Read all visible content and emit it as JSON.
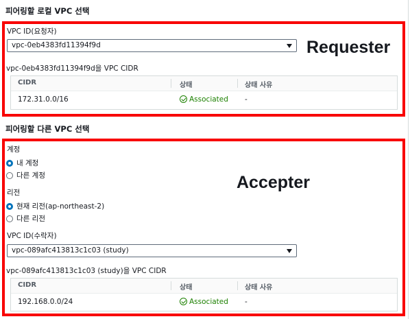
{
  "local": {
    "title": "피어링할 로컬 VPC 선택",
    "vpc_label": "VPC ID(요청자)",
    "vpc_value": "vpc-0eb4383fd11394f9d",
    "cidr_caption": "vpc-0eb4383fd11394f9d을 VPC CIDR",
    "table": {
      "columns": [
        "CIDR",
        "상태",
        "상태 사유"
      ],
      "row": {
        "cidr": "172.31.0.0/16",
        "status": "Associated",
        "reason": "-"
      }
    },
    "annotation": "Requester"
  },
  "peer": {
    "title": "피어링할 다른 VPC 선택",
    "account_label": "계정",
    "account_options": [
      "내 계정",
      "다른 계정"
    ],
    "account_selected": "내 계정",
    "region_label": "리전",
    "region_options": [
      "현재 리전(ap-northeast-2)",
      "다른 리전"
    ],
    "region_selected": "현재 리전(ap-northeast-2)",
    "vpc_label": "VPC ID(수락자)",
    "vpc_value": "vpc-089afc413813c1c03 (study)",
    "cidr_caption": "vpc-089afc413813c1c03 (study)을 VPC CIDR",
    "table": {
      "columns": [
        "CIDR",
        "상태",
        "상태 사유"
      ],
      "row": {
        "cidr": "192.168.0.0/24",
        "status": "Associated",
        "reason": "-"
      }
    },
    "annotation": "Accepter"
  },
  "colors": {
    "highlight": "#f80000",
    "status_ok": "#1d8102",
    "radio_selected": "#0073bb"
  }
}
